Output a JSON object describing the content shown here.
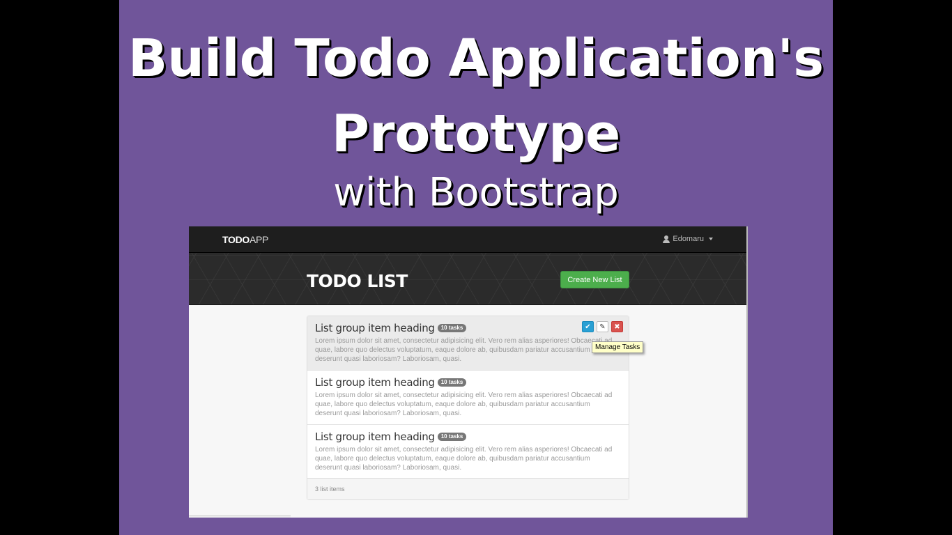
{
  "slide": {
    "title_line1": "Build Todo Application's",
    "title_line2": "Prototype",
    "title_line3": "with Bootstrap",
    "background": "#70559a"
  },
  "app": {
    "brand_bold": "TODO",
    "brand_light": "APP",
    "user_name": "Edomaru",
    "page_title": "TODO LIST",
    "create_button": "Create New List",
    "accent_green": "#4cae4c",
    "items": [
      {
        "heading": "List group item heading",
        "badge": "10 tasks",
        "text": "Lorem ipsum dolor sit amet, consectetur adipisicing elit. Vero rem alias asperiores! Obcaecati ad quae, labore quo delectus voluptatum, eaque dolore ab, quibusdam pariatur accusantium deserunt quasi laboriosam? Laboriosam, quasi."
      },
      {
        "heading": "List group item heading",
        "badge": "10 tasks",
        "text": "Lorem ipsum dolor sit amet, consectetur adipisicing elit. Vero rem alias asperiores! Obcaecati ad quae, labore quo delectus voluptatum, eaque dolore ab, quibusdam pariatur accusantium deserunt quasi laboriosam? Laboriosam, quasi."
      },
      {
        "heading": "List group item heading",
        "badge": "10 tasks",
        "text": "Lorem ipsum dolor sit amet, consectetur adipisicing elit. Vero rem alias asperiores! Obcaecati ad quae, labore quo delectus voluptatum, eaque dolore ab, quibusdam pariatur accusantium deserunt quasi laboriosam? Laboriosam, quasi."
      }
    ],
    "action_icons": [
      "check-icon",
      "edit-icon",
      "delete-icon"
    ],
    "tooltip": "Manage Tasks",
    "footer": "3 list items"
  }
}
